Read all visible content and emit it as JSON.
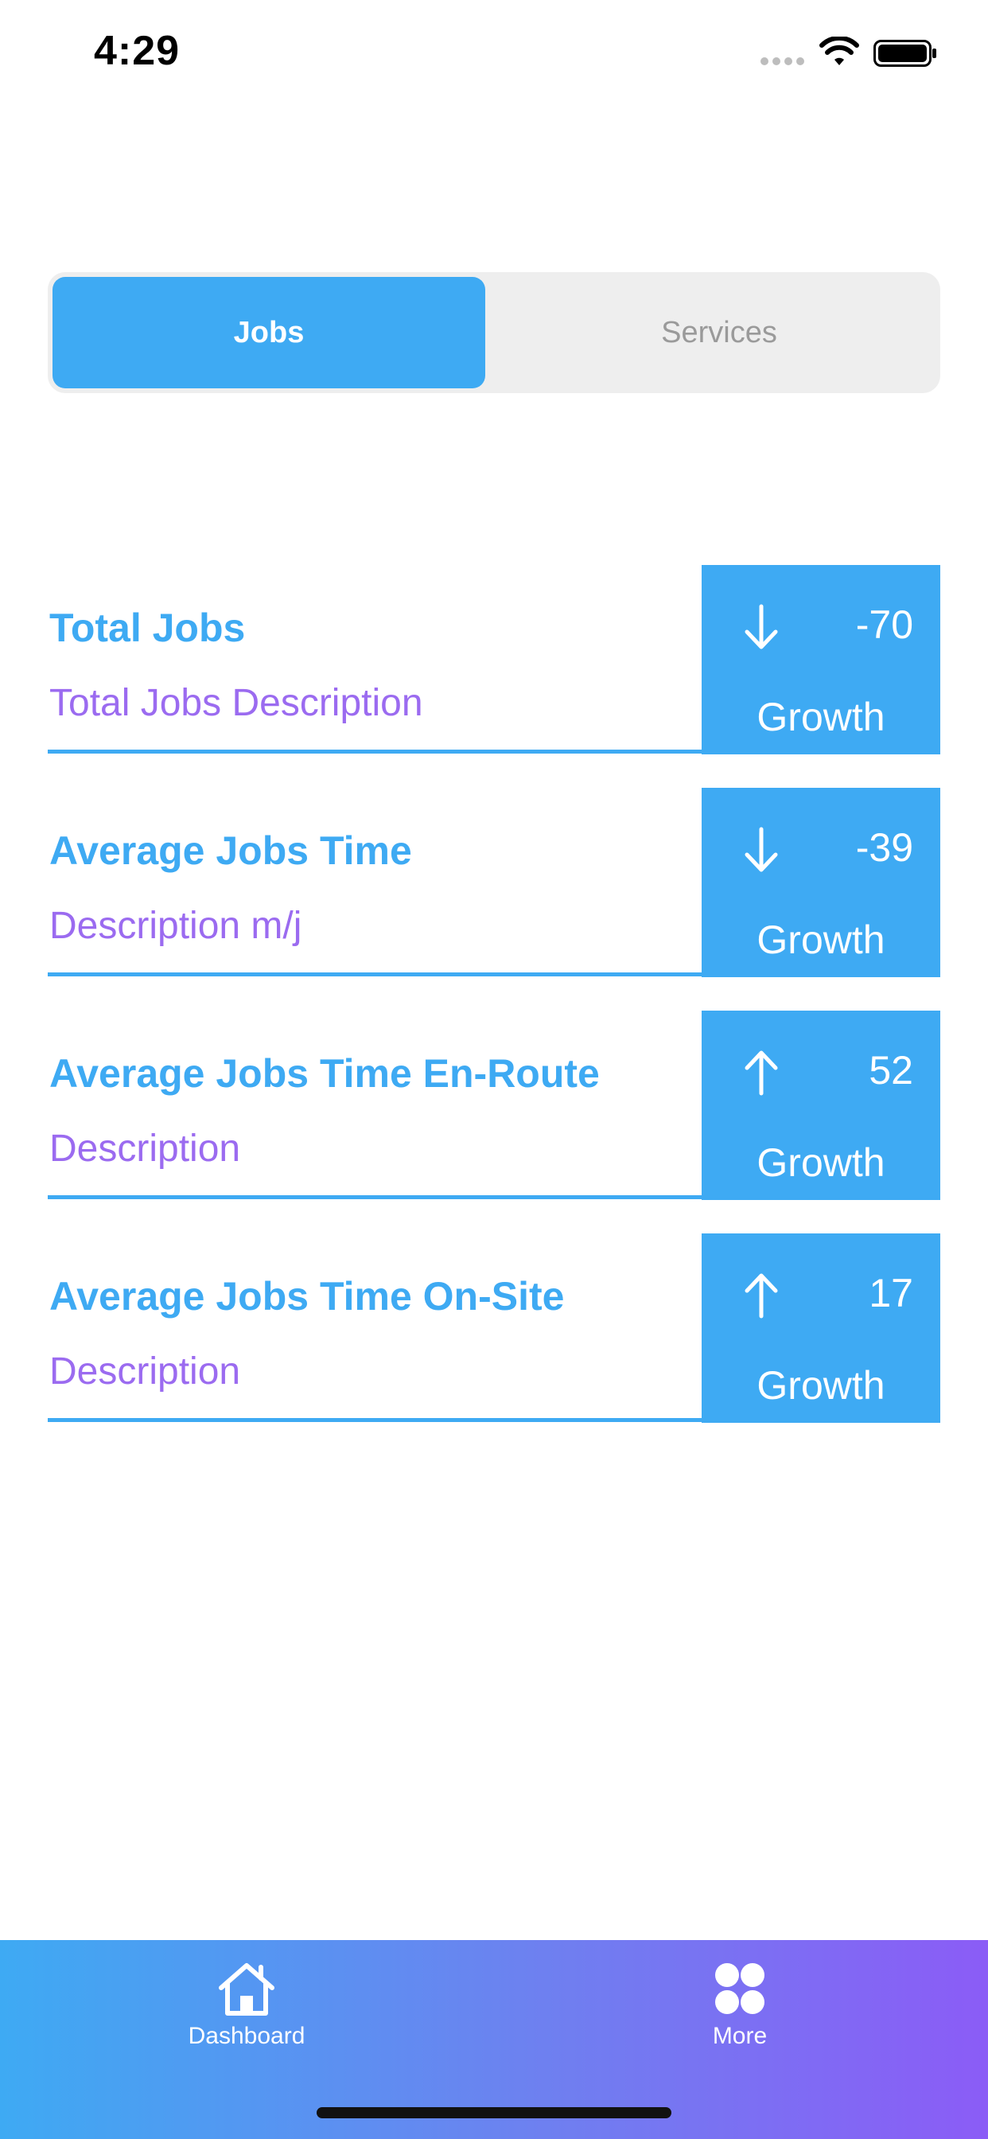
{
  "status_bar": {
    "time": "4:29"
  },
  "segmented": {
    "jobs_label": "Jobs",
    "services_label": "Services",
    "selected": "Jobs",
    "accent_color": "#3eaaf3"
  },
  "metrics": [
    {
      "title": "Total Jobs",
      "description": "Total Jobs Description",
      "direction": "down-arrow-icon",
      "value": "-70",
      "label": "Growth"
    },
    {
      "title": "Average Jobs Time",
      "description": "Description m/j",
      "direction": "down-arrow-icon",
      "value": "-39",
      "label": "Growth"
    },
    {
      "title": "Average Jobs Time En-Route",
      "description": "Description",
      "direction": "up-arrow-icon",
      "value": "52",
      "label": "Growth"
    },
    {
      "title": "Average Jobs Time On-Site",
      "description": "Description",
      "direction": "up-arrow-icon",
      "value": "17",
      "label": "Growth"
    }
  ],
  "colors": {
    "title": "#3eaaf3",
    "description": "#9b6bf0",
    "tab_bar_gradient": [
      "#3eaaf3",
      "#8b5cf6"
    ]
  },
  "tab_bar": {
    "items": [
      {
        "label": "Dashboard",
        "icon": "home-icon"
      },
      {
        "label": "More",
        "icon": "grid-dots-icon"
      }
    ]
  }
}
